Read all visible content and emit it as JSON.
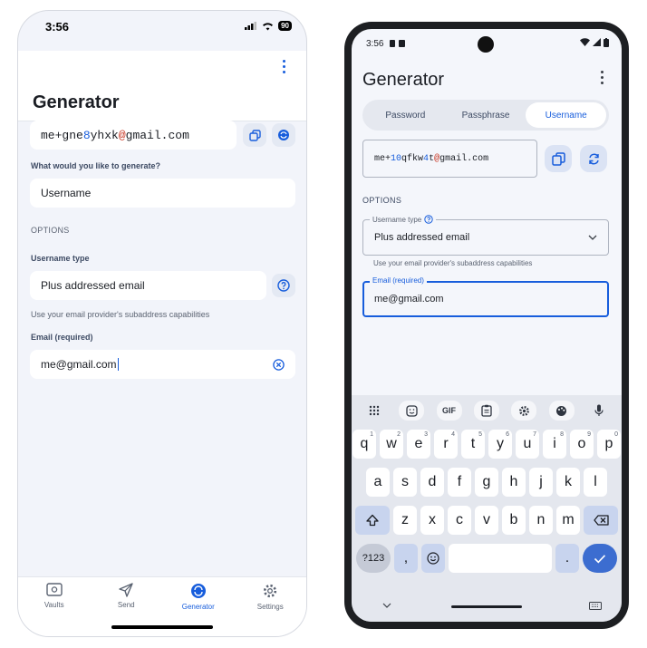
{
  "ios": {
    "status": {
      "time": "3:56",
      "battery": "90"
    },
    "title": "Generator",
    "generated": {
      "prefix": "me+",
      "p1": "gne",
      "d1": "8",
      "p2": "yhxk",
      "at": "@",
      "suffix": "gmail.com"
    },
    "question_label": "What would you like to generate?",
    "type_value": "Username",
    "options_header": "OPTIONS",
    "username_type_label": "Username type",
    "username_type_value": "Plus addressed email",
    "hint": "Use your email provider's subaddress capabilities",
    "email_label": "Email (required)",
    "email_value": "me@gmail.com",
    "tabs": [
      {
        "label": "Vaults",
        "icon": "vault-icon"
      },
      {
        "label": "Send",
        "icon": "send-icon"
      },
      {
        "label": "Generator",
        "icon": "generator-icon"
      },
      {
        "label": "Settings",
        "icon": "gear-icon"
      }
    ]
  },
  "android": {
    "status": {
      "time": "3:56"
    },
    "title": "Generator",
    "tabs": [
      "Password",
      "Passphrase",
      "Username"
    ],
    "generated": {
      "prefix": "me+",
      "d1": "10",
      "p1": "qfkw",
      "d2": "4",
      "p2": "t",
      "at": "@",
      "suffix": "gmail.com"
    },
    "options_header": "OPTIONS",
    "username_type_label": "Username type",
    "username_type_value": "Plus addressed email",
    "hint": "Use your email provider's subaddress capabilities",
    "email_label": "Email (required)",
    "email_value": "me@gmail.com",
    "keyboard": {
      "gif": "GIF",
      "row1": [
        "q",
        "w",
        "e",
        "r",
        "t",
        "y",
        "u",
        "i",
        "o",
        "p"
      ],
      "row1_hints": [
        "1",
        "2",
        "3",
        "4",
        "5",
        "6",
        "7",
        "8",
        "9",
        "0"
      ],
      "row2": [
        "a",
        "s",
        "d",
        "f",
        "g",
        "h",
        "j",
        "k",
        "l"
      ],
      "row3": [
        "z",
        "x",
        "c",
        "v",
        "b",
        "n",
        "m"
      ],
      "symbols": "?123",
      "comma": ",",
      "period": "."
    }
  },
  "colors": {
    "accent": "#175ddc",
    "symbol": "#c83522"
  }
}
